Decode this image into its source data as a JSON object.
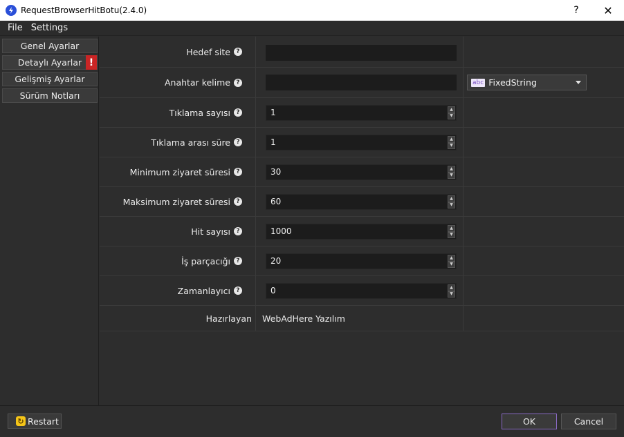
{
  "window": {
    "title": "RequestBrowserHitBotu(2.4.0)",
    "help_label": "?",
    "close_label": "✕"
  },
  "menu": {
    "items": [
      "File",
      "Settings"
    ]
  },
  "sidebar": {
    "items": [
      {
        "label": "Genel Ayarlar"
      },
      {
        "label": "Detaylı Ayarlar",
        "badge": "!"
      },
      {
        "label": "Gelişmiş Ayarlar"
      },
      {
        "label": "Sürüm Notları"
      }
    ],
    "active_index": 1
  },
  "form": {
    "help_icon_glyph": "?",
    "rows": [
      {
        "label": "Hedef site",
        "type": "text",
        "value": ""
      },
      {
        "label": "Anahtar kelime",
        "type": "text",
        "value": "",
        "combo": {
          "icon": "abc",
          "value": "FixedString"
        }
      },
      {
        "label": "Tıklama sayısı",
        "type": "spin",
        "value": "1"
      },
      {
        "label": "Tıklama arası süre",
        "type": "spin",
        "value": "1"
      },
      {
        "label": "Minimum ziyaret süresi",
        "type": "spin",
        "value": "30"
      },
      {
        "label": "Maksimum ziyaret süresi",
        "type": "spin",
        "value": "60"
      },
      {
        "label": "Hit sayısı",
        "type": "spin",
        "value": "1000"
      },
      {
        "label": "İş parçacığı",
        "type": "spin",
        "value": "20"
      },
      {
        "label": "Zamanlayıcı",
        "type": "spin",
        "value": "0"
      }
    ],
    "credit": {
      "label": "Hazırlayan",
      "value": "WebAdHere Yazılım"
    }
  },
  "buttons": {
    "restart": "Restart",
    "ok": "OK",
    "cancel": "Cancel"
  },
  "colors": {
    "background": "#2d2d2d",
    "input_background": "#1c1c1c",
    "warning_badge": "#c92525",
    "ok_border_accent": "#8b6bc6",
    "restart_icon": "#f5c518",
    "app_icon": "#2a4fd8"
  }
}
